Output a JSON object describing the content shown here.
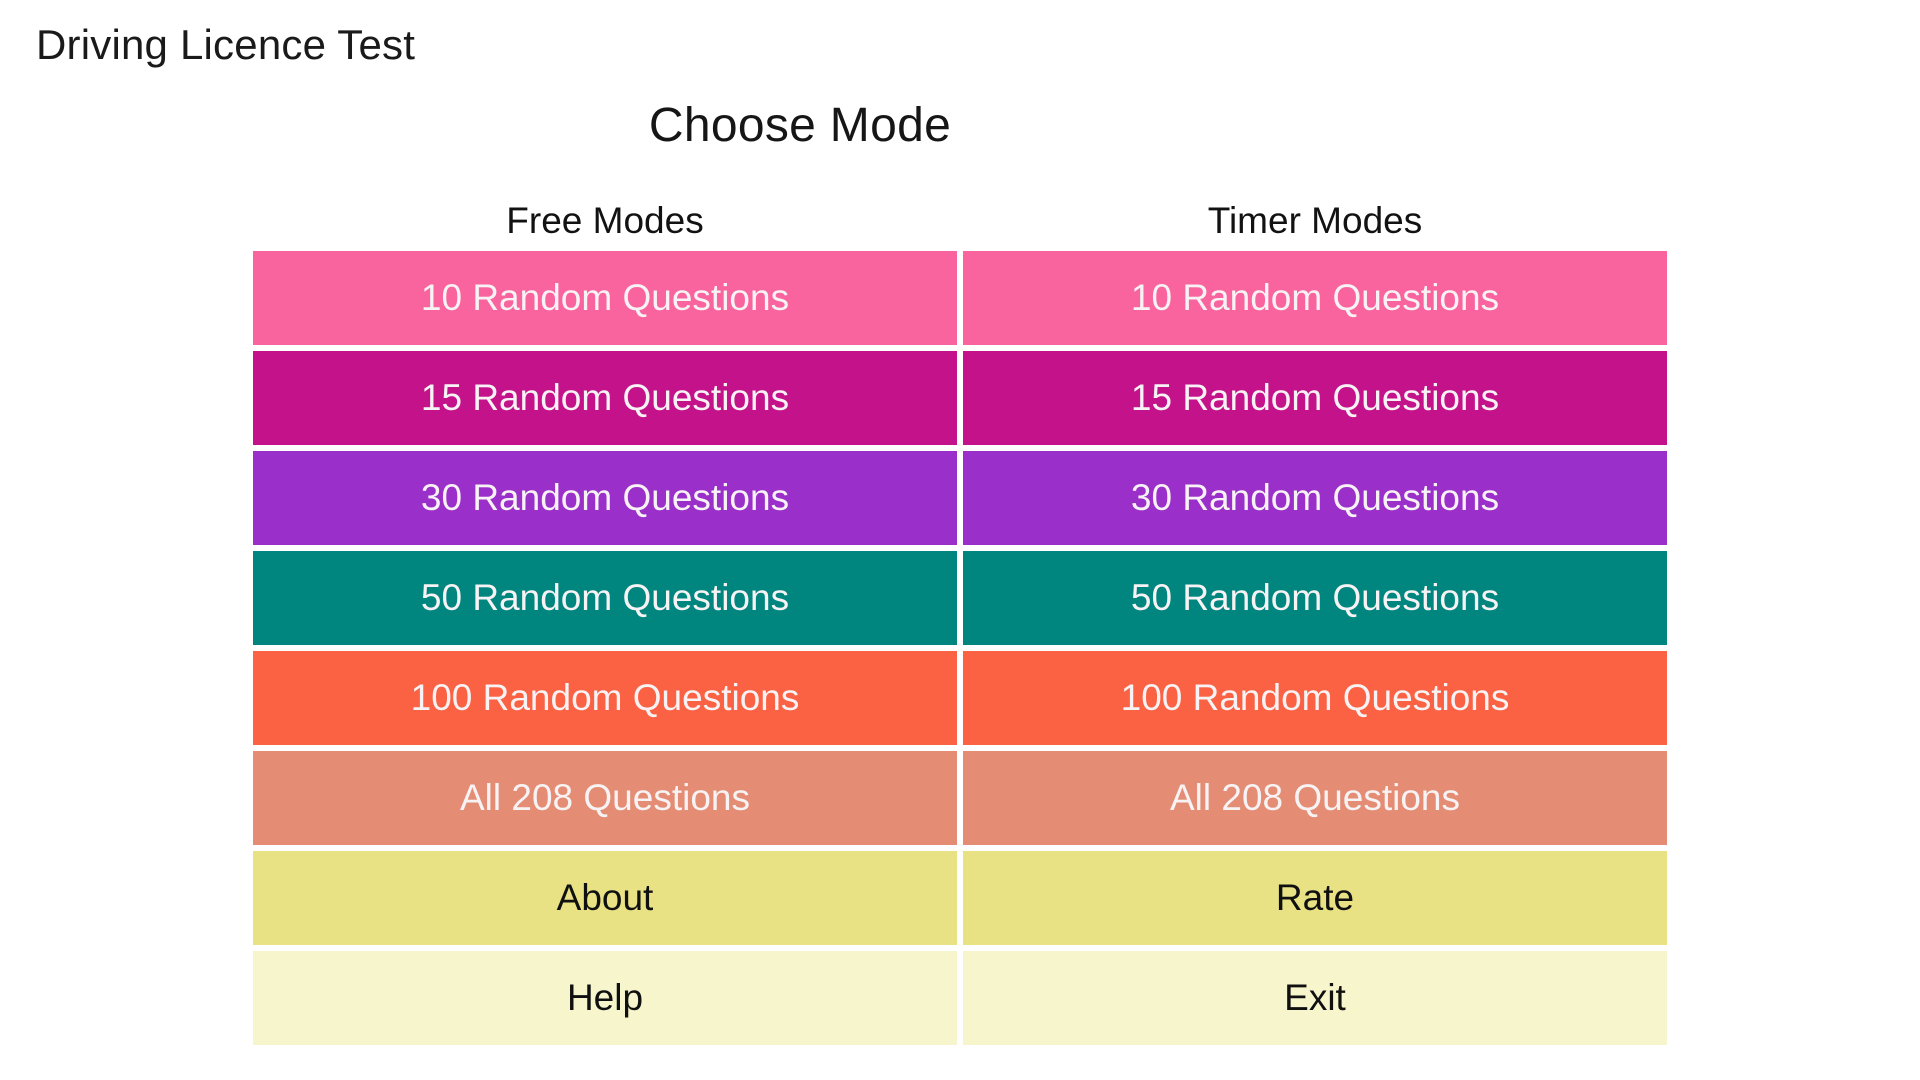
{
  "app": {
    "title": "Driving Licence Test",
    "heading": "Choose Mode"
  },
  "columns": [
    {
      "header": "Free Modes"
    },
    {
      "header": "Timer Modes"
    }
  ],
  "palette": {
    "hot_pink": "#f9649f",
    "magenta": "#c4128a",
    "purple": "#9b2fc9",
    "teal": "#00857f",
    "orange_red": "#fb6244",
    "salmon": "#e48d74",
    "khaki": "#e8e285",
    "pale_yellow": "#f7f5cc",
    "background": "#ffffff",
    "text_light": "#f7f3f4",
    "text_dark": "#101010"
  },
  "rows": [
    {
      "free": {
        "label": "10 Random Questions",
        "color": "#f9649f",
        "text": "light"
      },
      "timer": {
        "label": "10 Random Questions",
        "color": "#f9649f",
        "text": "light"
      }
    },
    {
      "free": {
        "label": "15 Random Questions",
        "color": "#c4128a",
        "text": "light"
      },
      "timer": {
        "label": "15 Random Questions",
        "color": "#c4128a",
        "text": "light"
      }
    },
    {
      "free": {
        "label": "30 Random Questions",
        "color": "#9b2fc9",
        "text": "light"
      },
      "timer": {
        "label": "30 Random Questions",
        "color": "#9b2fc9",
        "text": "light"
      }
    },
    {
      "free": {
        "label": "50 Random Questions",
        "color": "#00857f",
        "text": "light"
      },
      "timer": {
        "label": "50 Random Questions",
        "color": "#00857f",
        "text": "light"
      }
    },
    {
      "free": {
        "label": "100 Random Questions",
        "color": "#fb6244",
        "text": "light"
      },
      "timer": {
        "label": "100 Random Questions",
        "color": "#fb6244",
        "text": "light"
      }
    },
    {
      "free": {
        "label": "All 208 Questions",
        "color": "#e48d74",
        "text": "light"
      },
      "timer": {
        "label": "All 208 Questions",
        "color": "#e48d74",
        "text": "light"
      }
    },
    {
      "free": {
        "label": "About",
        "color": "#e8e285",
        "text": "dark"
      },
      "timer": {
        "label": "Rate",
        "color": "#e8e285",
        "text": "dark"
      }
    },
    {
      "free": {
        "label": "Help",
        "color": "#f7f5cc",
        "text": "dark"
      },
      "timer": {
        "label": "Exit",
        "color": "#f7f5cc",
        "text": "dark"
      }
    }
  ]
}
